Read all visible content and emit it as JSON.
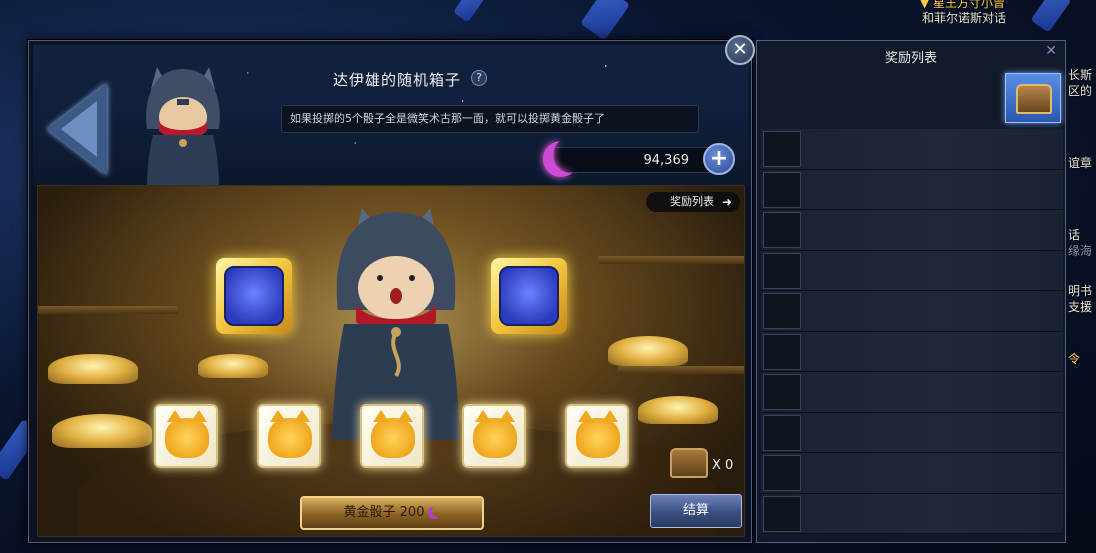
{
  "world": {
    "quest_line1": "▼ 星王方寸小曾",
    "quest_line2": "和菲尔诺斯对话",
    "edge_texts": [
      "长斯",
      "区的",
      "谊章",
      "话",
      "缘海",
      "明书",
      "支援",
      "令"
    ]
  },
  "window": {
    "title": "达伊雄的随机箱子",
    "help_label": "?",
    "description": "如果投掷的5个骰子全是微笑术古那一面，就可以投掷黄金骰子了",
    "currency_value": "94,369",
    "plus_label": "+",
    "close_label": "✕"
  },
  "scene": {
    "reward_list_link": "奖励列表",
    "reward_list_arrow": "➜",
    "chest_count": "X 0",
    "gold_dice_button": "黄金骰子 200",
    "settle_button": "结算",
    "gold_slots": [
      "blue-cat-face-icon",
      "blue-cat-face-icon"
    ],
    "dice": [
      "yellow-cat-face-icon",
      "yellow-cat-face-icon",
      "yellow-cat-face-icon",
      "yellow-cat-face-icon",
      "yellow-cat-face-icon"
    ]
  },
  "side_panel": {
    "title": "奖励列表",
    "close_label": "✕",
    "reward_rows": 10
  },
  "colors": {
    "accent_blue": "#3a4f80",
    "gold": "#f2c53c",
    "moon_purple": "#d04ad8"
  }
}
